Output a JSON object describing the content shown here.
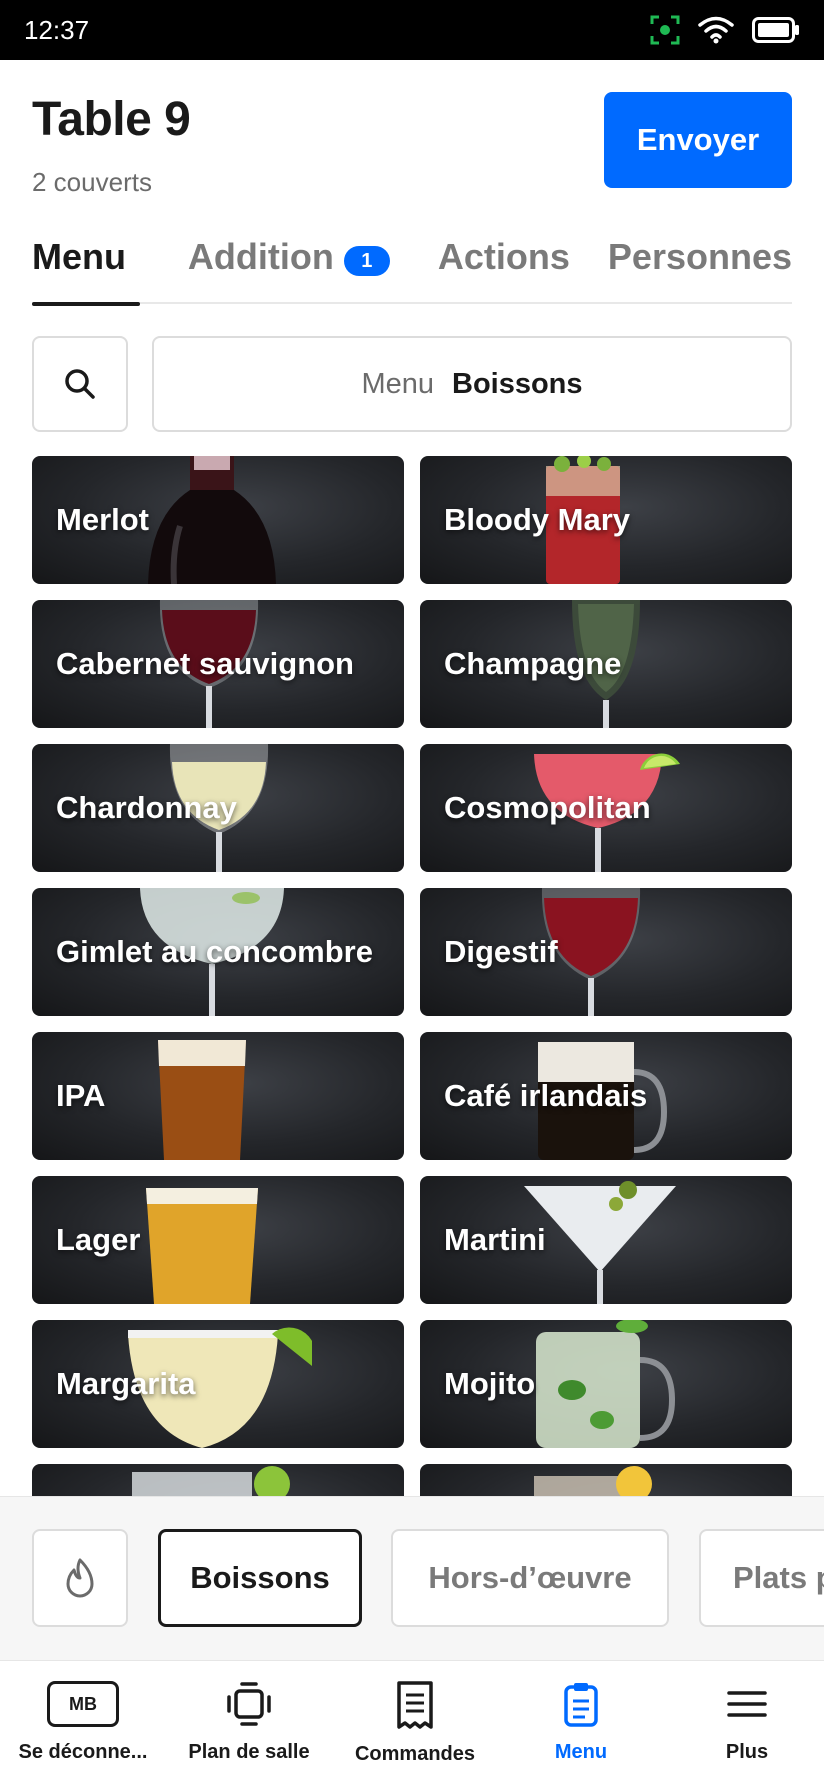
{
  "status_bar": {
    "time": "12:37"
  },
  "header": {
    "title": "Table 9",
    "subtitle": "2 couverts",
    "send_label": "Envoyer"
  },
  "tabs": [
    {
      "label": "Menu",
      "active": true
    },
    {
      "label": "Addition",
      "badge": "1"
    },
    {
      "label": "Actions"
    },
    {
      "label": "Personnes"
    }
  ],
  "breadcrumb": {
    "root": "Menu",
    "current": "Boissons"
  },
  "items": [
    {
      "name": "Merlot",
      "art": "bottle"
    },
    {
      "name": "Bloody Mary",
      "art": "tall-red"
    },
    {
      "name": "Cabernet sauvignon",
      "art": "wine-red"
    },
    {
      "name": "Champagne",
      "art": "flute"
    },
    {
      "name": "Chardonnay",
      "art": "wine-white"
    },
    {
      "name": "Cosmopolitan",
      "art": "coupe-pink"
    },
    {
      "name": "Gimlet au concombre",
      "art": "coupe-clear"
    },
    {
      "name": "Digestif",
      "art": "wine-dark"
    },
    {
      "name": "IPA",
      "art": "beer-amber"
    },
    {
      "name": "Café irlandais",
      "art": "mug"
    },
    {
      "name": "Lager",
      "art": "beer-gold"
    },
    {
      "name": "Martini",
      "art": "martini"
    },
    {
      "name": "Margarita",
      "art": "margarita"
    },
    {
      "name": "Mojito",
      "art": "mojito"
    },
    {
      "name": "",
      "art": "ice"
    },
    {
      "name": "",
      "art": "lemon"
    }
  ],
  "categories": [
    {
      "label": "",
      "icon": "flame-icon"
    },
    {
      "label": "Boissons",
      "active": true
    },
    {
      "label": "Hors-d’œuvre"
    },
    {
      "label": "Plats p"
    }
  ],
  "bottom_nav": [
    {
      "label": "Se déconne...",
      "icon": "avatar",
      "initials": "MB"
    },
    {
      "label": "Plan de salle",
      "icon": "floor-plan-icon"
    },
    {
      "label": "Commandes",
      "icon": "receipt-icon"
    },
    {
      "label": "Menu",
      "icon": "menu-clipboard-icon",
      "active": true
    },
    {
      "label": "Plus",
      "icon": "hamburger-icon"
    }
  ],
  "colors": {
    "accent": "#006aff",
    "text": "#1a1a1a",
    "muted": "#6b6b6b",
    "status_green": "#1fb954"
  }
}
